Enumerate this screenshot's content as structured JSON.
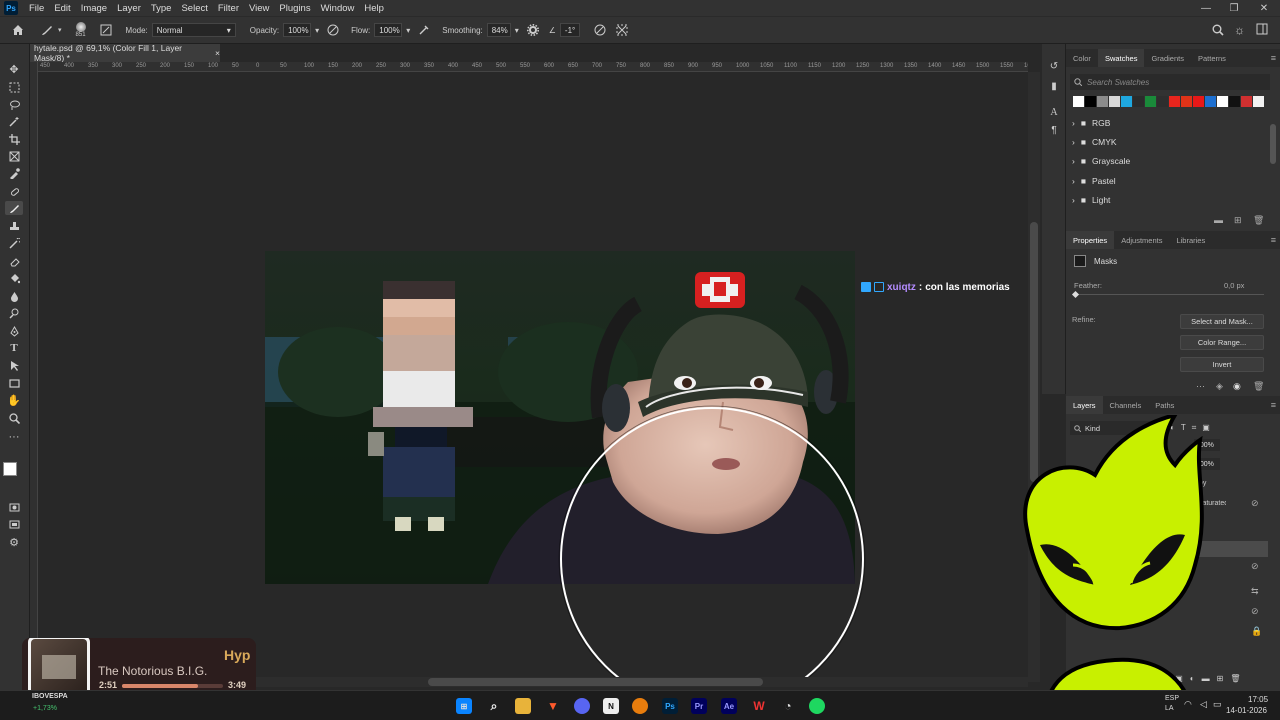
{
  "app": {
    "logo": "Ps"
  },
  "menu": [
    "File",
    "Edit",
    "Image",
    "Layer",
    "Type",
    "Select",
    "Filter",
    "View",
    "Plugins",
    "Window",
    "Help"
  ],
  "options": {
    "brush_size": "851",
    "mode_label": "Mode:",
    "mode_value": "Normal",
    "opacity_label": "Opacity:",
    "opacity_value": "100%",
    "flow_label": "Flow:",
    "flow_value": "100%",
    "smoothing_label": "Smoothing:",
    "smoothing_value": "84%",
    "angle_value": "-1°"
  },
  "document": {
    "tab_title": "hytale.psd @ 69,1% (Color Fill 1, Layer Mask/8) *",
    "close_glyph": "×"
  },
  "ruler": {
    "h_ticks": [
      "450",
      "400",
      "350",
      "300",
      "250",
      "200",
      "150",
      "100",
      "50",
      "0",
      "50",
      "100",
      "150",
      "200",
      "250",
      "300",
      "350",
      "400",
      "450",
      "500",
      "550",
      "600",
      "650",
      "700",
      "750",
      "800",
      "850",
      "900",
      "950",
      "1000",
      "1050",
      "1100",
      "1150",
      "1200",
      "1250",
      "1300",
      "1350",
      "1400",
      "1450",
      "1500",
      "1550",
      "1600"
    ]
  },
  "swatches_panel": {
    "tabs": [
      "Color",
      "Swatches",
      "Gradients",
      "Patterns"
    ],
    "active_tab": "Swatches",
    "search_placeholder": "Search Swatches",
    "colors": [
      "#ffffff",
      "#000000",
      "#8c8c8c",
      "#d9d9d9",
      "#1fa8e0",
      "#2b2b2b",
      "#1a8a3a",
      "#2e2e2e",
      "#e8251d",
      "#e03318",
      "#e81818",
      "#1d6fd0",
      "#ffffff",
      "#111111",
      "#d03030",
      "#f2f2f2"
    ],
    "folders": [
      "RGB",
      "CMYK",
      "Grayscale",
      "Pastel",
      "Light"
    ]
  },
  "properties_panel": {
    "tabs": [
      "Properties",
      "Adjustments",
      "Libraries"
    ],
    "active_tab": "Properties",
    "section": "Masks",
    "feather_label": "Feather:",
    "feather_value": "0,0 px",
    "refine_label": "Refine:",
    "buttons": [
      "Select and Mask...",
      "Color Range...",
      "Invert"
    ]
  },
  "layers_panel": {
    "tabs": [
      "Layers",
      "Channels",
      "Paths"
    ],
    "active_tab": "Layers",
    "filter_label": "Kind",
    "opacity_value": "100%",
    "fill_value": "100%",
    "layer_names": [
      "Copy",
      "Desaturated"
    ]
  },
  "chat": {
    "username": "xuiqtz",
    "separator": " : ",
    "message": "con las memorias"
  },
  "music": {
    "title": "Hyp",
    "artist": "The Notorious B.I.G.",
    "elapsed": "2:51",
    "duration": "3:49",
    "progress": 0.75
  },
  "stock": {
    "name": "IBOVESPA",
    "change": "+1,73%"
  },
  "tray": {
    "lang": "ESP",
    "lang2": "LA",
    "time": "17:05",
    "date": "14-01-2026"
  },
  "colors": {
    "accent": "#31a8ff",
    "bg": "#282828",
    "panel": "#323232",
    "mascot": "#c8f000"
  }
}
